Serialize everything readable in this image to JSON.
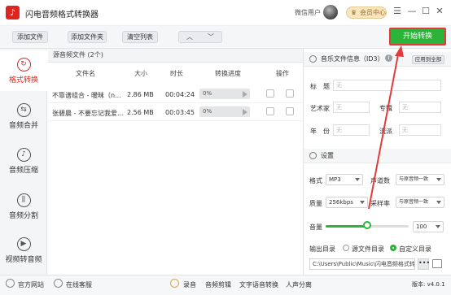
{
  "app": {
    "title": "闪电音频格式转换器",
    "user": "微信用户",
    "vip_label": "会员中心"
  },
  "window_controls": {
    "menu": "☰",
    "minimize": "—",
    "maximize": "☐",
    "close": "✕"
  },
  "toolbar": {
    "add_file": "添加文件",
    "add_folder": "添加文件夹",
    "clear_list": "清空列表",
    "up": "︿",
    "down": "﹀",
    "start": "开始转换"
  },
  "sidebar": {
    "items": [
      {
        "label": "格式转换",
        "icon": "refresh-icon",
        "glyph": "↻"
      },
      {
        "label": "音频合并",
        "icon": "merge-icon",
        "glyph": "⇆"
      },
      {
        "label": "音频压缩",
        "icon": "compress-icon",
        "glyph": "♪"
      },
      {
        "label": "音频分割",
        "icon": "split-icon",
        "glyph": "⫼"
      },
      {
        "label": "视频转音频",
        "icon": "video-icon",
        "glyph": "▶"
      }
    ]
  },
  "filelist": {
    "header": "源音频文件 (2个)",
    "columns": {
      "name": "文件名",
      "size": "大小",
      "duration": "时长",
      "progress": "转换进度",
      "action": "操作"
    },
    "rows": [
      {
        "name": "不靠谱组合 - 暧昧（n...",
        "size": "2.86 MB",
        "duration": "00:04:24",
        "progress": "0%"
      },
      {
        "name": "张碧晨 - 不要忘记我爱...",
        "size": "2.56 MB",
        "duration": "00:03:45",
        "progress": "0%"
      }
    ]
  },
  "id3": {
    "section": "音乐文件信息（ID3）",
    "apply_all": "应用到全部",
    "info": "i",
    "title_label": "标　题",
    "artist_label": "艺术家",
    "album_label": "专辑",
    "year_label": "年　份",
    "genre_label": "流派",
    "placeholder": "无"
  },
  "settings": {
    "section": "设置",
    "format_label": "格式",
    "format_value": "MP3",
    "channel_label": "声道数",
    "channel_value": "与原音频一致",
    "quality_label": "质量",
    "quality_value": "256kbps",
    "samplerate_label": "采样率",
    "samplerate_value": "与原音频一致",
    "volume_label": "音量",
    "volume_value": "100",
    "volume_level": 0.5,
    "output_label": "输出目录",
    "source_dir": "源文件目录",
    "custom_dir": "自定义目录",
    "path": "C:\\Users\\Public\\Music\\闪电音频格式转换",
    "browse": "•••"
  },
  "bottom": {
    "website": "官方网站",
    "support": "在线客服",
    "record": "录音",
    "edit": "音频剪辑",
    "tts": "文字语音转换",
    "vocal": "人声分离",
    "version": "版本: v4.0.1"
  },
  "colors": {
    "accent": "#2bb33a",
    "brand": "#e0251e",
    "annotation": "#e23b3b"
  }
}
